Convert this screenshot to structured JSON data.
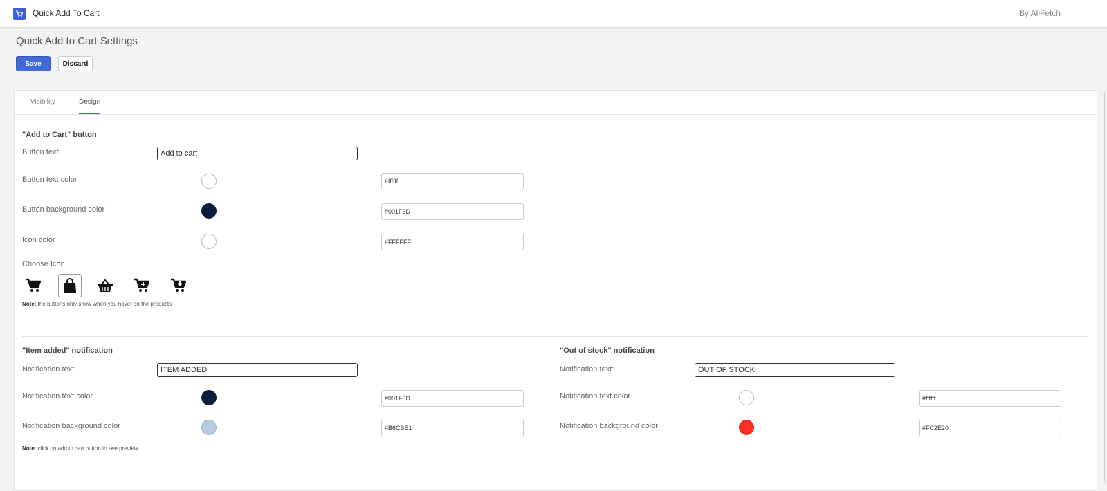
{
  "app": {
    "title": "Quick Add To Cart",
    "by": "By AllFetch",
    "logo_icon": "cart-logo-icon"
  },
  "page": {
    "title": "Quick Add to Cart Settings"
  },
  "actions": {
    "save": "Save",
    "discard": "Discard"
  },
  "tabs": [
    {
      "label": "Visibility",
      "active": false
    },
    {
      "label": "Design",
      "active": true
    }
  ],
  "add_to_cart": {
    "section_title": "\"Add to Cart\" button",
    "button_text_label": "Button text:",
    "button_text_value": "Add to cart",
    "text_color_label": "Button text color",
    "text_color_value": "#ffffff",
    "bg_color_label": "Button background color",
    "bg_color_value": "#001F3D",
    "icon_color_label": "Icon color",
    "icon_color_value": "#FFFFFF",
    "choose_icon_label": "Choose Icon",
    "icons": [
      "cart-icon",
      "shopping-bag-icon",
      "basket-icon",
      "cart-plus-icon",
      "cart-plus-alt-icon"
    ],
    "selected_icon": "shopping-bag-icon",
    "note_bold": "Note:",
    "note_text": " the buttons only show when you hover on the products"
  },
  "item_added": {
    "section_title": "\"Item added\" notification",
    "text_label": "Notification text:",
    "text_value": "ITEM ADDED",
    "text_color_label": "Notification text color",
    "text_color_value": "#001F3D",
    "bg_color_label": "Notification background color",
    "bg_color_value": "#B6CBE1",
    "note_bold": "Note:",
    "note_text": " click on add to cart button to see preview"
  },
  "out_of_stock": {
    "section_title": "\"Out of stock\" notification",
    "text_label": "Notification text:",
    "text_value": "OUT OF STOCK",
    "text_color_label": "Notification text color",
    "text_color_value": "#ffffff",
    "bg_color_label": "Notification background color",
    "bg_color_value": "#FC2E20"
  },
  "colors": {
    "accent": "#3f6ad8",
    "swatch_navy": "#0a1d3a",
    "swatch_light_blue": "#b6cbe1",
    "swatch_red": "#fc2e20",
    "swatch_white": "#ffffff"
  }
}
